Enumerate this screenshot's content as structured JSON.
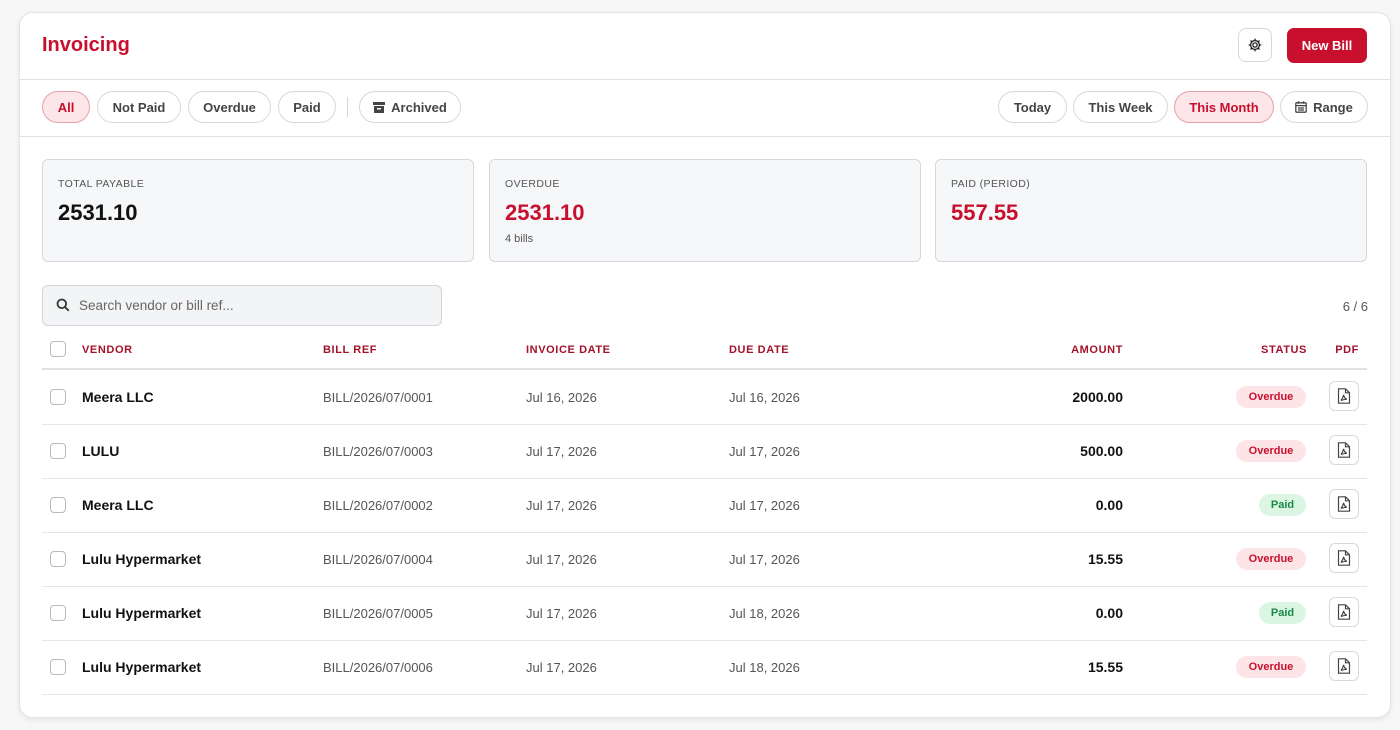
{
  "header": {
    "title": "Invoicing",
    "new_bill_label": "New Bill"
  },
  "status_filters": [
    {
      "label": "All",
      "active": true
    },
    {
      "label": "Not Paid",
      "active": false
    },
    {
      "label": "Overdue",
      "active": false
    },
    {
      "label": "Paid",
      "active": false
    }
  ],
  "archived_label": "Archived",
  "period_filters": [
    {
      "label": "Today",
      "active": false
    },
    {
      "label": "This Week",
      "active": false
    },
    {
      "label": "This Month",
      "active": true
    }
  ],
  "range_label": "Range",
  "stats": {
    "total_payable": {
      "label": "TOTAL PAYABLE",
      "value": "2531.10"
    },
    "overdue": {
      "label": "OVERDUE",
      "value": "2531.10",
      "sub": "4 bills"
    },
    "paid": {
      "label": "PAID (PERIOD)",
      "value": "557.55"
    }
  },
  "search": {
    "placeholder": "Search vendor or bill ref...",
    "value": ""
  },
  "count": "6 / 6",
  "table": {
    "columns": {
      "vendor": "VENDOR",
      "bill_ref": "BILL REF",
      "invoice_date": "INVOICE DATE",
      "due_date": "DUE DATE",
      "amount": "AMOUNT",
      "status": "STATUS",
      "pdf": "PDF"
    },
    "rows": [
      {
        "vendor": "Meera LLC",
        "bill_ref": "BILL/2026/07/0001",
        "invoice_date": "Jul 16, 2026",
        "due_date": "Jul 16, 2026",
        "amount": "2000.00",
        "status": "Overdue"
      },
      {
        "vendor": "LULU",
        "bill_ref": "BILL/2026/07/0003",
        "invoice_date": "Jul 17, 2026",
        "due_date": "Jul 17, 2026",
        "amount": "500.00",
        "status": "Overdue"
      },
      {
        "vendor": "Meera LLC",
        "bill_ref": "BILL/2026/07/0002",
        "invoice_date": "Jul 17, 2026",
        "due_date": "Jul 17, 2026",
        "amount": "0.00",
        "status": "Paid"
      },
      {
        "vendor": "Lulu Hypermarket",
        "bill_ref": "BILL/2026/07/0004",
        "invoice_date": "Jul 17, 2026",
        "due_date": "Jul 17, 2026",
        "amount": "15.55",
        "status": "Overdue"
      },
      {
        "vendor": "Lulu Hypermarket",
        "bill_ref": "BILL/2026/07/0005",
        "invoice_date": "Jul 17, 2026",
        "due_date": "Jul 18, 2026",
        "amount": "0.00",
        "status": "Paid"
      },
      {
        "vendor": "Lulu Hypermarket",
        "bill_ref": "BILL/2026/07/0006",
        "invoice_date": "Jul 17, 2026",
        "due_date": "Jul 18, 2026",
        "amount": "15.55",
        "status": "Overdue"
      }
    ]
  },
  "colors": {
    "accent": "#c8102e",
    "paid": "#1a8a43"
  }
}
